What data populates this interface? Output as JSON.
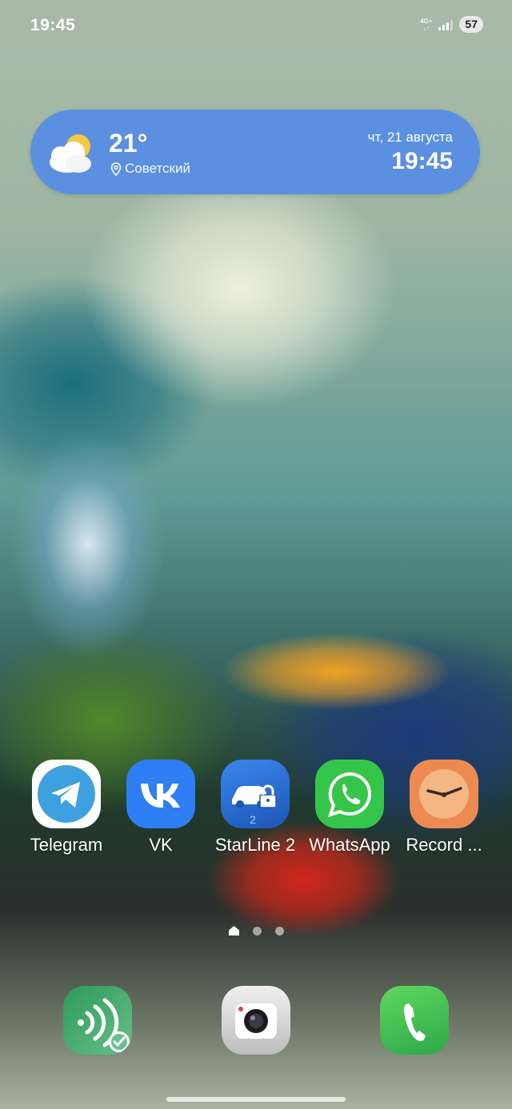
{
  "status_bar": {
    "time": "19:45",
    "network_type": "4G+",
    "battery": "57"
  },
  "weather_widget": {
    "icon": "partly-cloudy-icon",
    "temperature": "21°",
    "location": "Советский",
    "date": "чт, 21 августа",
    "time": "19:45",
    "background_color": "#5b90e0"
  },
  "apps": [
    {
      "label": "Telegram",
      "icon": "telegram-icon",
      "color": "#3fa0e0"
    },
    {
      "label": "VK",
      "icon": "vk-icon",
      "color": "#2f7ef5"
    },
    {
      "label": "StarLine 2",
      "icon": "starline-icon",
      "color": "#2d6fd6"
    },
    {
      "label": "WhatsApp",
      "icon": "whatsapp-icon",
      "color": "#35c54b"
    },
    {
      "label": "Record ...",
      "icon": "clock-icon",
      "color": "#ec8a52"
    }
  ],
  "page_indicator": {
    "pages": 3,
    "current": 1
  },
  "dock": [
    {
      "icon": "voice-assistant-icon",
      "color": "#3aa86a"
    },
    {
      "icon": "camera-icon",
      "color": "#e0e0e0"
    },
    {
      "icon": "phone-icon",
      "color": "#3fbf4c"
    }
  ]
}
